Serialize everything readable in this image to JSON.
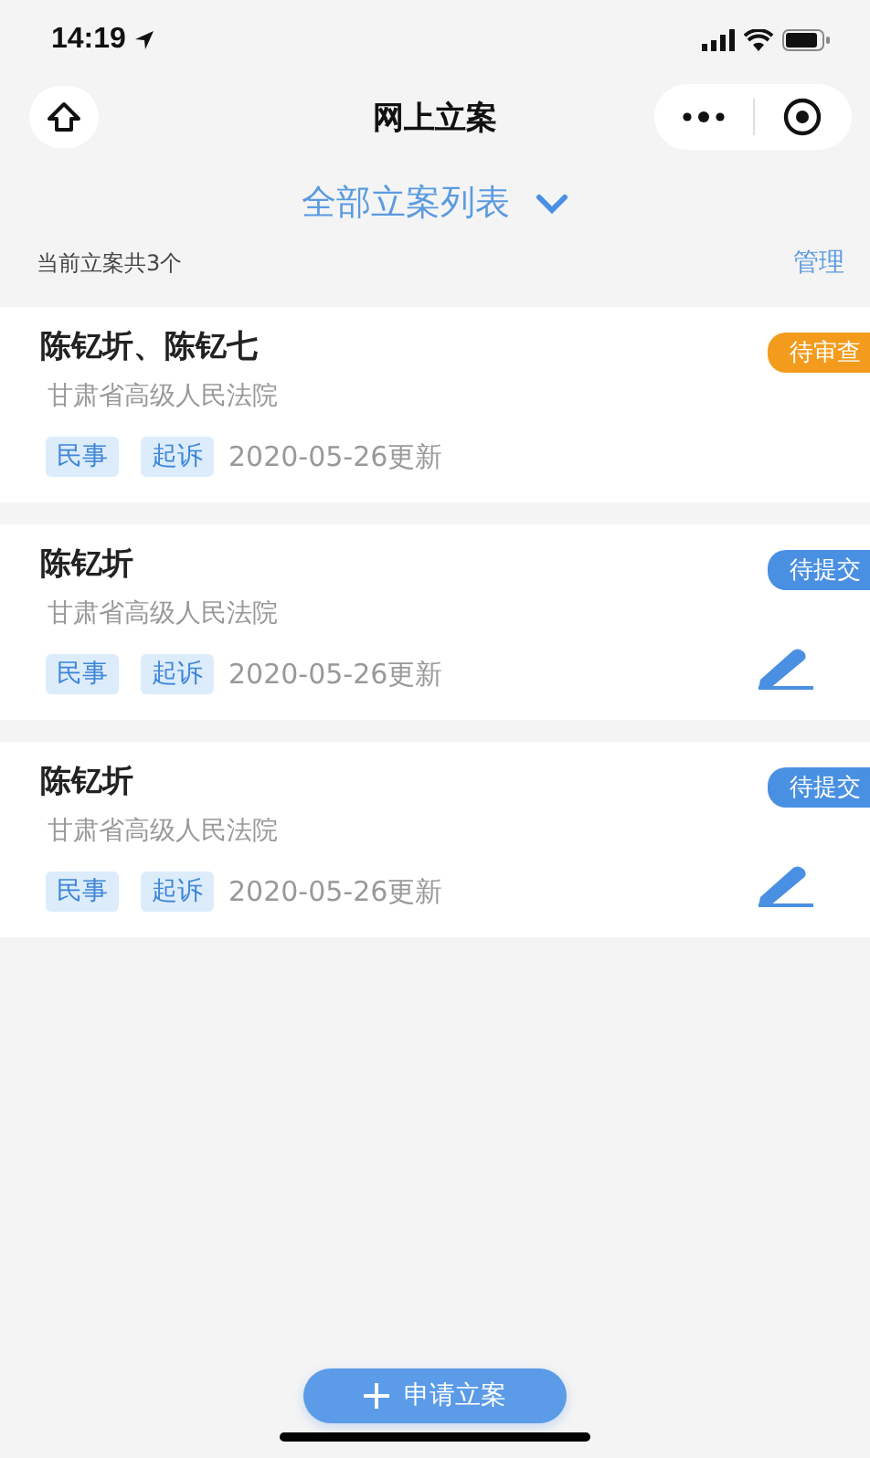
{
  "status_bar": {
    "time": "14:19"
  },
  "nav": {
    "title": "网上立案"
  },
  "filter": {
    "label": "全部立案列表"
  },
  "summary": {
    "count_text": "当前立案共3个",
    "manage": "管理"
  },
  "cases": [
    {
      "parties": "陈钇圻、陈钇七",
      "court": "甘肃省高级人民法院",
      "tags": [
        "民事",
        "起诉"
      ],
      "updated": "2020-05-26更新",
      "status": "待审查",
      "kind": "review",
      "editable": false
    },
    {
      "parties": "陈钇圻",
      "court": "甘肃省高级人民法院",
      "tags": [
        "民事",
        "起诉"
      ],
      "updated": "2020-05-26更新",
      "status": "待提交",
      "kind": "draft",
      "editable": true
    },
    {
      "parties": "陈钇圻",
      "court": "甘肃省高级人民法院",
      "tags": [
        "民事",
        "起诉"
      ],
      "updated": "2020-05-26更新",
      "status": "待提交",
      "kind": "draft",
      "editable": true
    }
  ],
  "apply_button": {
    "label": "申请立案"
  }
}
